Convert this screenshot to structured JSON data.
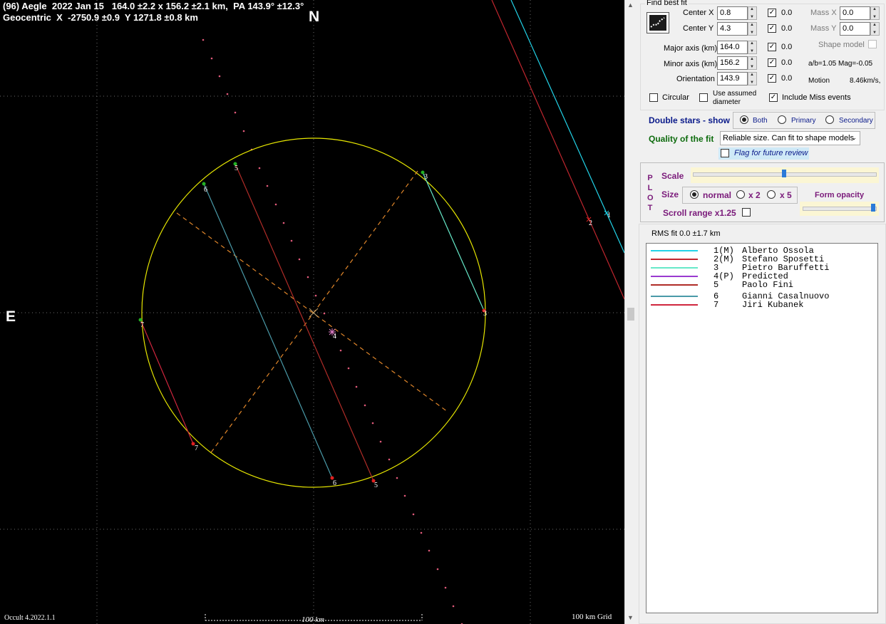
{
  "plot": {
    "header_line1": "(96) Aegle  2022 Jan 15   164.0 ±2.2 x 156.2 ±2.1 km,  PA 143.9° ±12.3°",
    "header_line2": "Geocentric  X  -2750.9 ±0.9  Y 1271.8 ±0.8 km",
    "north": "N",
    "east": "E",
    "version": "Occult 4.2022.1.1",
    "scale_label": "100 km",
    "grid_label": "100 km Grid",
    "chord_numbers": [
      "1",
      "2",
      "3",
      "3",
      "4",
      "5",
      "5",
      "6",
      "6",
      "7",
      "7"
    ],
    "colors": {
      "ellipse": "#e6e600",
      "axes": "#e0862a",
      "grid": "#6c6c6c",
      "predicted_path": "#e05a7a"
    }
  },
  "fit": {
    "title": "Find best fit",
    "center_x_label": "Center X",
    "center_x_value": "0.8",
    "center_x_weight": "0.0",
    "center_y_label": "Center Y",
    "center_y_value": "4.3",
    "center_y_weight": "0.0",
    "mass_x_label": "Mass X",
    "mass_x_value": "0.0",
    "mass_y_label": "Mass Y",
    "mass_y_value": "0.0",
    "shape_model_label": "Shape model",
    "major_label": "Major axis (km)",
    "major_value": "164.0",
    "major_weight": "0.0",
    "minor_label": "Minor axis (km)",
    "minor_value": "156.2",
    "minor_weight": "0.0",
    "orient_label": "Orientation",
    "orient_value": "143.9",
    "orient_weight": "0.0",
    "ab_ratio": "a/b=1.05  Mag=-0.05",
    "motion_label": "Motion",
    "motion_value": "8.46km/s, ",
    "circular_label": "Circular",
    "assumed_label": "Use assumed diameter",
    "miss_label": "Include Miss events"
  },
  "double": {
    "label": "Double stars - show",
    "options": [
      "Both",
      "Primary",
      "Secondary"
    ]
  },
  "quality": {
    "label": "Quality of the fit",
    "value": "Reliable size. Can fit to shape models",
    "flag_label": "Flag for future review"
  },
  "plot_settings": {
    "side_label": "P L O T",
    "scale_label": "Scale",
    "size_label": "Size",
    "size_options": [
      "normal",
      "x 2",
      "x 5"
    ],
    "opacity_label": "Form opacity",
    "scroll_label": "Scroll range x1.25",
    "scale_level": 0.5,
    "opacity_level": 1.0
  },
  "rms": "RMS fit 0.0 ±1.7 km",
  "legend": [
    {
      "num": "1(M)",
      "name": "Alberto Ossola",
      "color": "#22d3e8"
    },
    {
      "num": "2(M)",
      "name": "Stefano Sposetti",
      "color": "#c0262e"
    },
    {
      "num": "3",
      "name": "Pietro Baruffetti",
      "color": "#66e8c8"
    },
    {
      "num": "4(P)",
      "name": "Predicted",
      "color": "#9a3ad0"
    },
    {
      "num": "5",
      "name": "Paolo Fini",
      "color": "#b02c28"
    },
    {
      "num": "6",
      "name": "Gianni Casalnuovo",
      "color": "#4a9aa8"
    },
    {
      "num": "7",
      "name": "Jiri Kubanek",
      "color": "#d0263e"
    }
  ]
}
